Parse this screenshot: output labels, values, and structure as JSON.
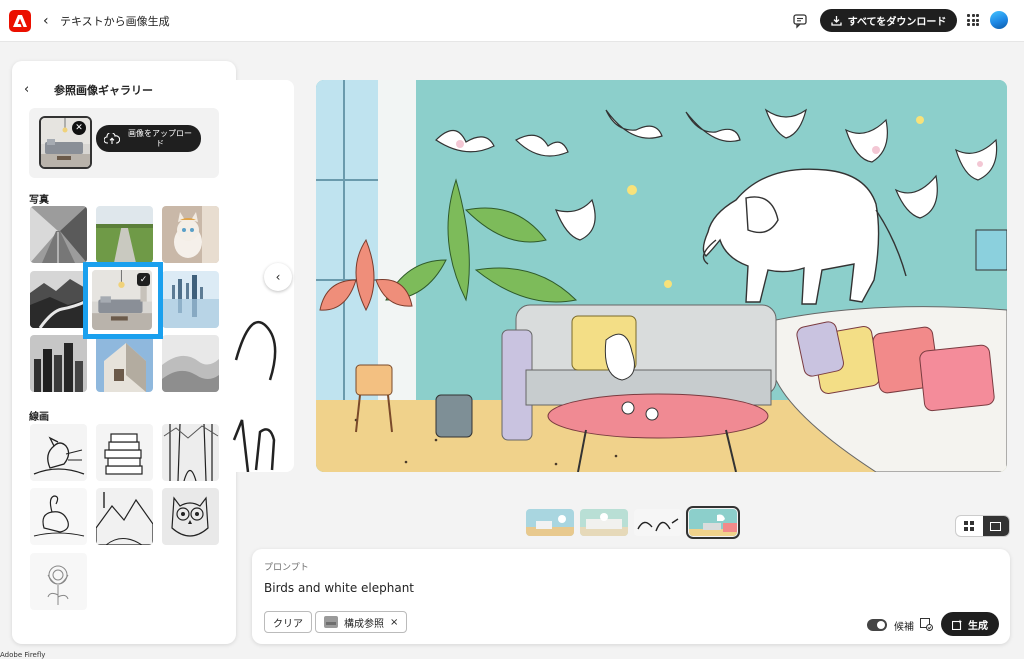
{
  "header": {
    "title": "テキストから画像生成",
    "download_all": "すべてをダウンロード"
  },
  "gallery": {
    "title": "参照画像ギャラリー",
    "upload_label": "画像をアップロード",
    "section_photo": "写真",
    "section_lineart": "線画"
  },
  "prompt": {
    "label": "プロンプト",
    "text": "Birds and white elephant",
    "clear": "クリア",
    "structure_ref": "構成参照",
    "candidates": "候補",
    "generate": "生成"
  },
  "footer": {
    "brand": "Adobe Firefly"
  },
  "colors": {
    "accent": "#1aa0ee",
    "logo": "#eb1000",
    "dark_button": "#1f1f1f"
  },
  "icons": [
    "adobe-logo",
    "chevron-left-icon",
    "feedback-icon",
    "download-icon",
    "apps-grid-icon",
    "avatar",
    "cloud-upload-icon",
    "close-icon",
    "checkmark-icon",
    "grid-view-icon",
    "single-view-icon",
    "generate-icon"
  ]
}
